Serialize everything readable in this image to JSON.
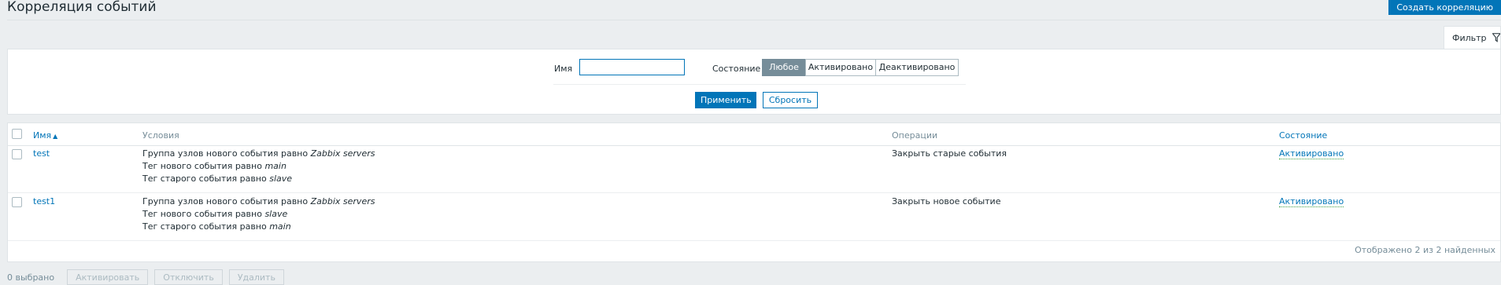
{
  "header": {
    "title": "Корреляция событий",
    "create_label": "Создать корреляцию"
  },
  "filter": {
    "tab_label": "Фильтр",
    "name_label": "Имя",
    "name_value": "",
    "status_label": "Состояние",
    "status_options": [
      "Любое",
      "Активировано",
      "Деактивировано"
    ],
    "status_selected": "Любое",
    "apply_label": "Применить",
    "reset_label": "Сбросить"
  },
  "table": {
    "columns": {
      "name": "Имя",
      "sort_indicator": "▲",
      "conditions": "Условия",
      "operations": "Операции",
      "status": "Состояние"
    },
    "rows": [
      {
        "name": "test",
        "conditions": [
          {
            "prefix": "Группа узлов нового события равно ",
            "value": "Zabbix servers"
          },
          {
            "prefix": "Тег нового события равно ",
            "value": "main"
          },
          {
            "prefix": "Тег старого события равно ",
            "value": "slave"
          }
        ],
        "operations": "Закрыть старые события",
        "status": "Активировано"
      },
      {
        "name": "test1",
        "conditions": [
          {
            "prefix": "Группа узлов нового события равно ",
            "value": "Zabbix servers"
          },
          {
            "prefix": "Тег нового события равно ",
            "value": "slave"
          },
          {
            "prefix": "Тег старого события равно ",
            "value": "main"
          }
        ],
        "operations": "Закрыть новое событие",
        "status": "Активировано"
      }
    ],
    "footer": "Отображено 2 из 2 найденных"
  },
  "bulk": {
    "selected": "0 выбрано",
    "enable_label": "Активировать",
    "disable_label": "Отключить",
    "delete_label": "Удалить"
  },
  "colors": {
    "accent": "#0275b8",
    "active_status": "#429e47",
    "segment_selected": "#768d99"
  }
}
